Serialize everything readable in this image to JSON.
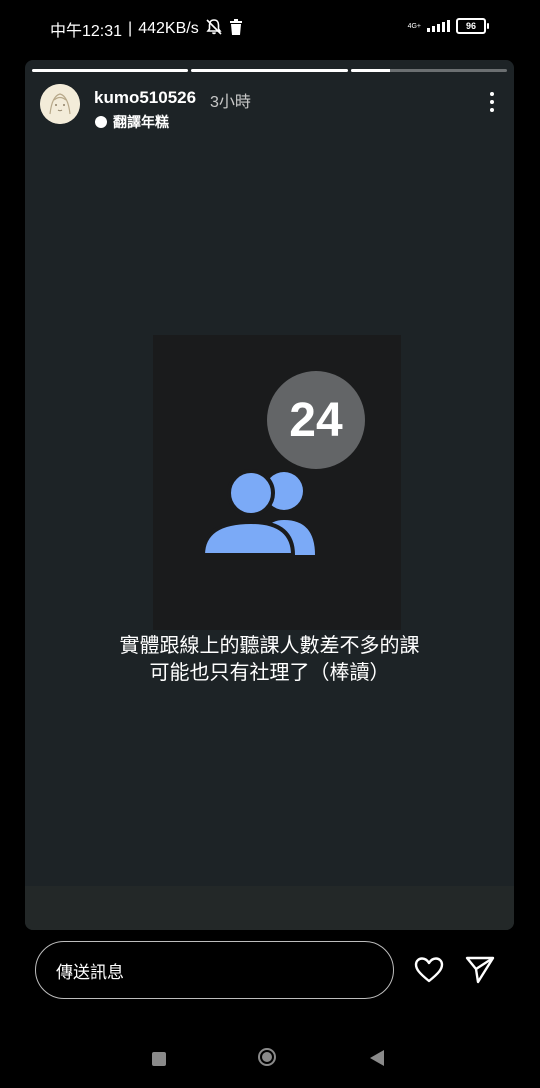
{
  "status_bar": {
    "time": "中午12:31",
    "separator": "|",
    "speed": "442KB/s",
    "network_type": "4G+",
    "battery": "96",
    "icons": [
      "mute-bell-icon",
      "trash-icon",
      "signal-icon",
      "battery-icon"
    ]
  },
  "story": {
    "progress": [
      1.0,
      1.0,
      0.25
    ],
    "username": "kumo510526",
    "time_ago": "3小時",
    "music": "翻譯年糕",
    "badge_count": "24",
    "caption_line1": "實體跟線上的聽課人數差不多的課",
    "caption_line2": "可能也只有社理了（棒讀）"
  },
  "reply": {
    "placeholder": "傳送訊息"
  },
  "colors": {
    "story_bg": "#1d2326",
    "badge_bg": "#636567",
    "people_icon": "#7baaf7"
  },
  "navigation": {
    "icons": [
      "recents-square-icon",
      "home-circle-icon",
      "back-triangle-icon"
    ]
  }
}
